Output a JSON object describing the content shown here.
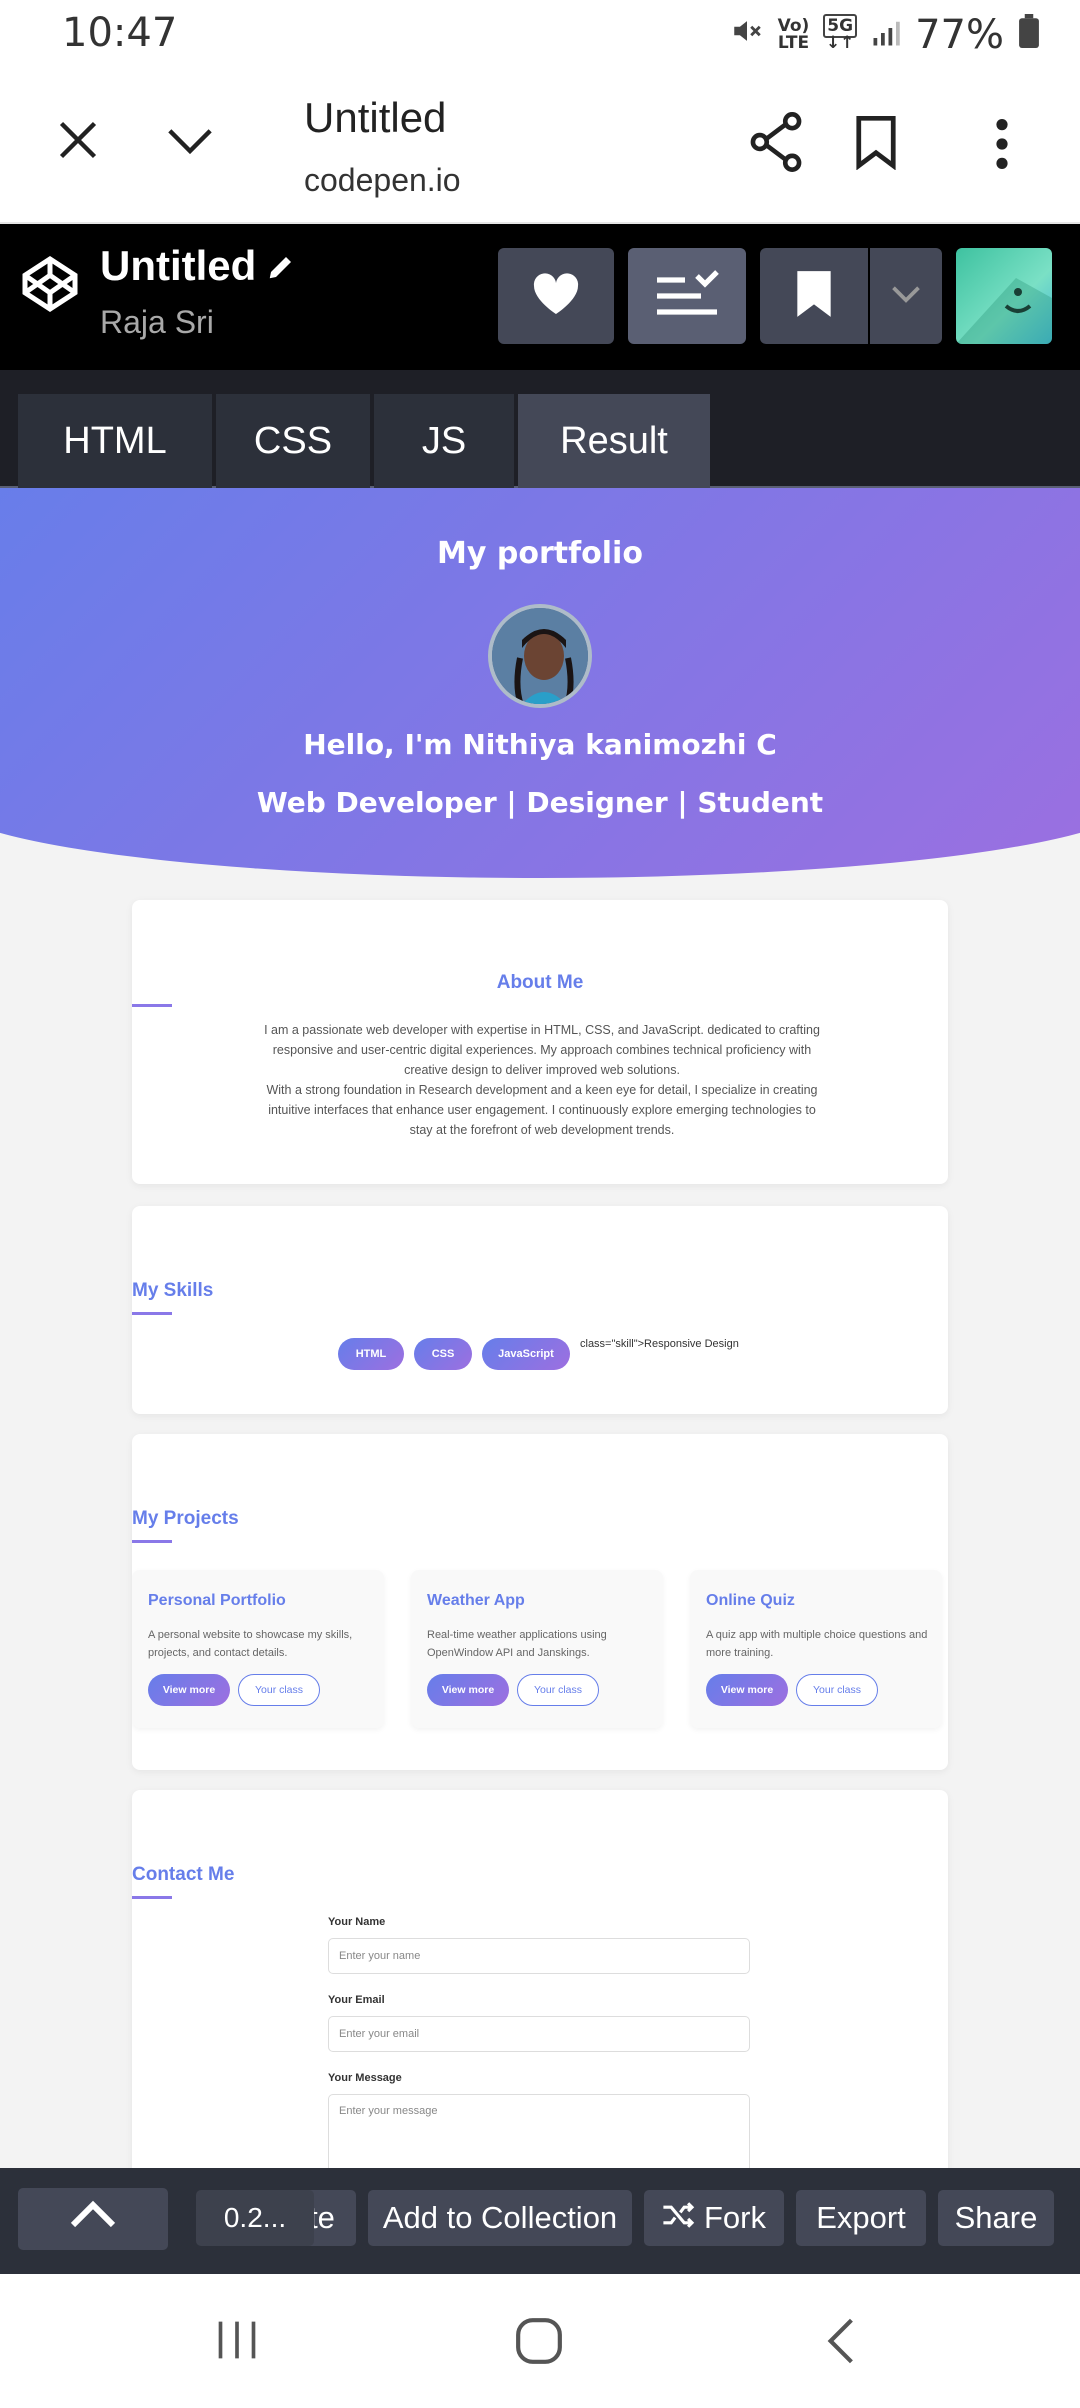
{
  "status_bar": {
    "time": "10:47",
    "battery": "77%",
    "volte": "Vo)\nLTE",
    "network": "5G"
  },
  "browser": {
    "title": "Untitled",
    "url": "codepen.io"
  },
  "codepen": {
    "title": "Untitled",
    "author": "Raja Sri"
  },
  "tabs": [
    {
      "label": "HTML"
    },
    {
      "label": "CSS"
    },
    {
      "label": "JS"
    },
    {
      "label": "Result"
    }
  ],
  "portfolio": {
    "header_title": "My portfolio",
    "greeting": "Hello, I'm Nithiya kanimozhi C",
    "tagline": "Web Developer | Designer | Student",
    "about": {
      "title": "About Me",
      "text": "I am a passionate web developer with expertise in HTML, CSS, and JavaScript. dedicated to crafting responsive and user-centric digital experiences. My approach combines technical proficiency with creative design to deliver improved web solutions.\nWith a strong foundation in Research development and a keen eye for detail, I specialize in creating intuitive interfaces that enhance user engagement. I continuously explore emerging technologies to stay at the forefront of web development trends."
    },
    "skills": {
      "title": "My Skills",
      "items": [
        "HTML",
        "CSS",
        "JavaScript"
      ],
      "stray_text": "class=\"skill\">Responsive Design"
    },
    "projects": {
      "title": "My Projects",
      "items": [
        {
          "name": "Personal Portfolio",
          "desc": "A personal website to showcase my skills, projects, and contact details.",
          "btn_primary": "View more",
          "btn_secondary": "Your class"
        },
        {
          "name": "Weather App",
          "desc": "Real-time weather applications using OpenWindow API and Janskings.",
          "btn_primary": "View more",
          "btn_secondary": "Your class"
        },
        {
          "name": "Online Quiz",
          "desc": "A quiz app with multiple choice questions and more training.",
          "btn_primary": "View more",
          "btn_secondary": "Your class"
        }
      ]
    },
    "contact": {
      "title": "Contact Me",
      "name_label": "Your Name",
      "name_placeholder": "Enter your name",
      "email_label": "Your Email",
      "email_placeholder": "Enter your email",
      "message_label": "Your Message",
      "message_placeholder": "Enter your message"
    }
  },
  "bottom_bar": {
    "zoom": "0.2...",
    "partial_label": "te",
    "add_to_collection": "Add to Collection",
    "fork": "Fork",
    "export": "Export",
    "share": "Share"
  },
  "colors": {
    "accent": "#667eea",
    "gradient_end": "#9d6fe0",
    "codepen_bg": "#000000",
    "tab_bg": "#2c303a"
  }
}
